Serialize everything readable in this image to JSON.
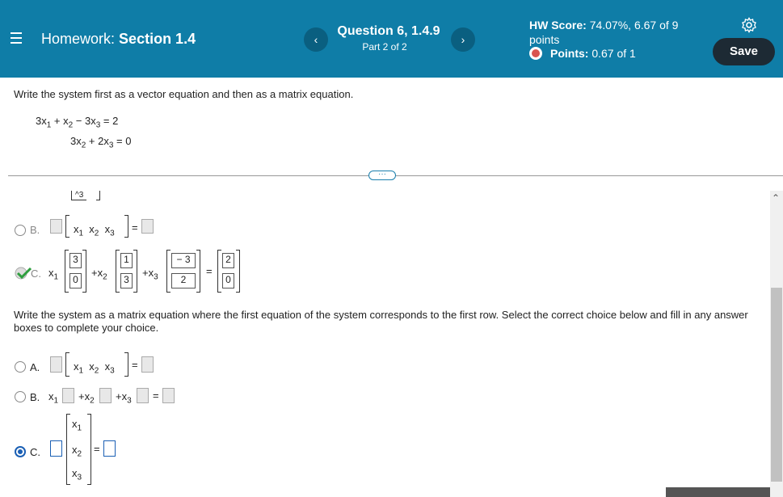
{
  "header": {
    "section_prefix": "Homework:",
    "section_name": "Section 1.4",
    "question_title": "Question 6, 1.4.9",
    "question_part": "Part 2 of 2",
    "hw_score_label": "HW Score:",
    "hw_score_value": "74.07%, 6.67 of 9",
    "hw_score_unit": "points",
    "points_label": "Points:",
    "points_value": "0.67 of 1",
    "save_label": "Save",
    "prev_arrow": "‹",
    "next_arrow": "›"
  },
  "problem": {
    "instruction": "Write the system first as a vector equation and then as a matrix equation.",
    "eq1": {
      "c1": "3x",
      "s1": "1",
      "op1": " + ",
      "c2": "x",
      "s2": "2",
      "op2": " − ",
      "c3": "3x",
      "s3": "3",
      "rhs": " = 2"
    },
    "eq2": {
      "c2": "3x",
      "s2": "2",
      "op": " + ",
      "c3": "2x",
      "s3": "3",
      "rhs": " = 0"
    },
    "more_label": "···"
  },
  "part1": {
    "partial_matrix": "^3",
    "optB_label": "B.",
    "optC_label": "C.",
    "x1": "x",
    "x1s": "1",
    "x2": "x",
    "x2s": "2",
    "x3": "x",
    "x3s": "3",
    "plus": "+",
    "eq": "=",
    "v1": [
      "3",
      "0"
    ],
    "v2": [
      "1",
      "3"
    ],
    "v3": [
      "− 3",
      "2"
    ],
    "rhs": [
      "2",
      "0"
    ]
  },
  "part2": {
    "instruction": "Write the system as a matrix equation where the first equation of the system corresponds to the first row. Select the correct choice below and fill in any answer boxes to complete your choice.",
    "optA_label": "A.",
    "optB_label": "B.",
    "optC_label": "C.",
    "x": "x",
    "s1": "1",
    "s2": "2",
    "s3": "3",
    "plus": "+",
    "eq": "="
  },
  "colors": {
    "header": "#0f7da7",
    "save": "#1d2a34",
    "selected": "#1a5fb4",
    "check": "#2e9e3e"
  }
}
